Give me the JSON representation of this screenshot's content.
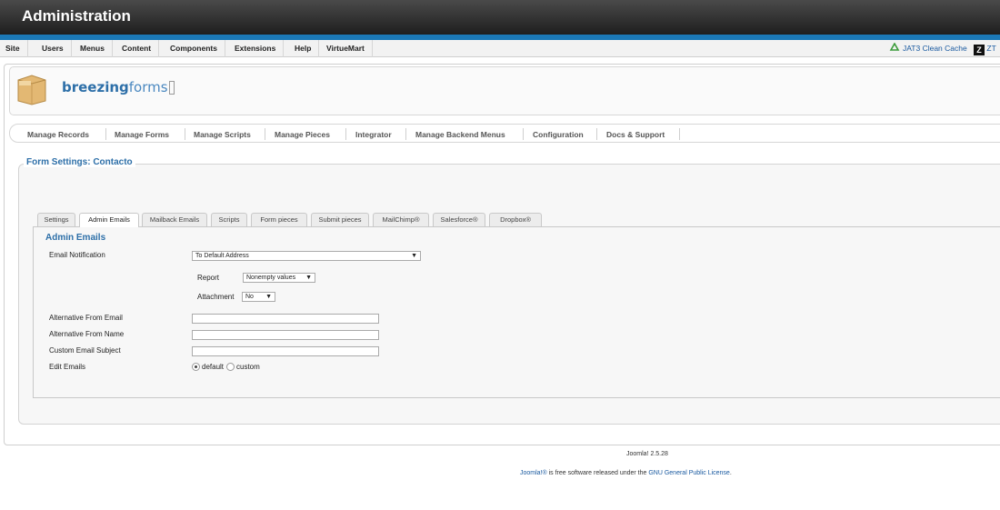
{
  "header": {
    "title": "Administration"
  },
  "menubar": {
    "items": [
      "Site",
      "Users",
      "Menus",
      "Content",
      "Components",
      "Extensions",
      "Help",
      "VirtueMart"
    ],
    "right": {
      "cache_label": "JAT3 Clean Cache",
      "zt_badge": "Z",
      "zt_label": "ZT"
    }
  },
  "logo": {
    "bold": "breezing",
    "light": "forms"
  },
  "submenu": {
    "items": [
      "Manage Records",
      "Manage Forms",
      "Manage Scripts",
      "Manage Pieces",
      "Integrator",
      "Manage Backend Menus",
      "Configuration",
      "Docs & Support"
    ]
  },
  "form": {
    "legend": "Form Settings: Contacto",
    "tabs": [
      "Settings",
      "Admin Emails",
      "Mailback Emails",
      "Scripts",
      "Form pieces",
      "Submit pieces",
      "MailChimp®",
      "Salesforce®",
      "Dropbox®"
    ],
    "active_tab": "Admin Emails",
    "section_title": "Admin Emails",
    "fields": {
      "email_notification": {
        "label": "Email Notification",
        "value": "To Default Address"
      },
      "report": {
        "label": "Report",
        "value": "Nonempty values"
      },
      "attachment": {
        "label": "Attachment",
        "value": "No"
      },
      "alt_from_email": {
        "label": "Alternative From Email",
        "value": ""
      },
      "alt_from_name": {
        "label": "Alternative From Name",
        "value": ""
      },
      "custom_subject": {
        "label": "Custom Email Subject",
        "value": ""
      },
      "edit_emails": {
        "label": "Edit Emails",
        "option_default": "default",
        "option_custom": "custom",
        "selected": "default"
      }
    }
  },
  "footer": {
    "version": "Joomla! 2.5.28",
    "license_link1": "Joomla!®",
    "license_text": " is free software released under the ",
    "license_link2": "GNU General Public License",
    "license_end": "."
  }
}
